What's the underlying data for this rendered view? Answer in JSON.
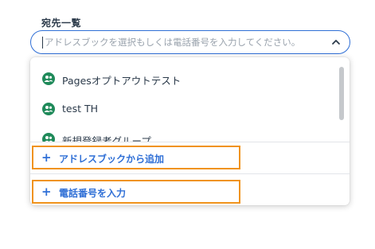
{
  "field": {
    "label": "宛先一覧",
    "placeholder": "アドレスブックを選択もしくは電話番号を入力してください。"
  },
  "dropdown": {
    "items": [
      {
        "label": "Pagesオプトアウトテスト",
        "icon": "group-icon"
      },
      {
        "label": "test TH",
        "icon": "group-icon"
      },
      {
        "label": "新規登録者グループ",
        "icon": "group-icon"
      }
    ],
    "actions": {
      "add_from_address_book": {
        "icon": "+",
        "label": "アドレスブックから追加"
      },
      "enter_phone_number": {
        "icon": "+",
        "label": "電話番号を入力"
      }
    }
  },
  "colors": {
    "accent": "#2f6fd6",
    "icon_green": "#1f8a5a",
    "highlight": "#f0931c"
  }
}
